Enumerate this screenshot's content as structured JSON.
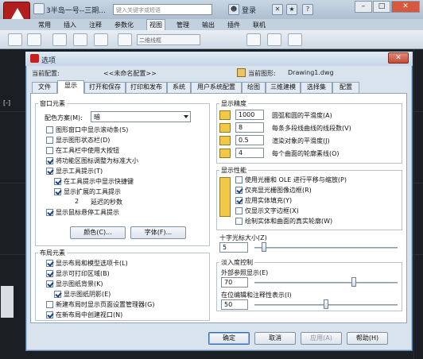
{
  "app": {
    "doc_title": "3半岛一号--三期...",
    "search_placeholder": "键入关键字或短语",
    "login": "登录",
    "ribbon_tabs": [
      "常用",
      "插入",
      "注释",
      "参数化",
      "视图",
      "管理",
      "输出",
      "插件",
      "联机"
    ],
    "active_ribbon_tab": "视图",
    "visual_style": "二维线框",
    "view_label": "[-]"
  },
  "dialog": {
    "title": "选项",
    "close_label": "✕",
    "current_profile_label": "当前配置:",
    "current_profile_value": "<<未命名配置>>",
    "current_drawing_label": "当前图形:",
    "current_drawing_value": "Drawing1.dwg",
    "tabs": [
      "文件",
      "显示",
      "打开和保存",
      "打印和发布",
      "系统",
      "用户系统配置",
      "绘图",
      "三维建模",
      "选择集",
      "配置"
    ],
    "active_tab": "显示",
    "window_elements": {
      "title": "窗口元素",
      "color_scheme_label": "配色方案(M):",
      "color_scheme_value": "暗",
      "checkboxes": [
        {
          "label": "图形窗口中显示滚动条(S)",
          "checked": false
        },
        {
          "label": "显示图形状态栏(D)",
          "checked": false
        },
        {
          "label": "在工具栏中使用大按钮",
          "checked": false
        },
        {
          "label": "将功能区图标调整为标准大小",
          "checked": true
        },
        {
          "label": "显示工具提示(T)",
          "checked": true
        }
      ],
      "sub_checkboxes": [
        {
          "label": "在工具提示中显示快捷键",
          "checked": true
        },
        {
          "label": "显示扩展的工具提示",
          "checked": true
        }
      ],
      "delay_value": "2",
      "delay_label": "延迟的秒数",
      "rollover_label": "显示鼠标悬停工具提示",
      "rollover_checked": true,
      "colors_button": "颜色(C)...",
      "fonts_button": "字体(F)..."
    },
    "layout_elements": {
      "title": "布局元素",
      "checkboxes": [
        {
          "label": "显示布局和模型选项卡(L)",
          "checked": true
        },
        {
          "label": "显示可打印区域(B)",
          "checked": true
        },
        {
          "label": "显示图纸背景(K)",
          "checked": true
        }
      ],
      "shadow_label": "显示图纸阴影(E)",
      "shadow_checked": true,
      "more": [
        {
          "label": "新建布局时显示页面设置管理器(G)",
          "checked": false
        },
        {
          "label": "在新布局中创建视口(N)",
          "checked": true
        }
      ]
    },
    "display_resolution": {
      "title": "显示精度",
      "rows": [
        {
          "value": "1000",
          "label": "圆弧和圆的平滑度(A)"
        },
        {
          "value": "8",
          "label": "每条多段线曲线的线段数(V)"
        },
        {
          "value": "0.5",
          "label": "渲染对象的平滑度(J)"
        },
        {
          "value": "4",
          "label": "每个曲面的轮廓素线(O)"
        }
      ]
    },
    "display_performance": {
      "title": "显示性能",
      "checkboxes": [
        {
          "label": "使用光栅和 OLE 进行平移与缩放(P)",
          "checked": false
        },
        {
          "label": "仅亮显光栅图像边框(R)",
          "checked": true
        },
        {
          "label": "应用实体填充(Y)",
          "checked": true
        },
        {
          "label": "仅显示文字边框(X)",
          "checked": false
        },
        {
          "label": "绘制实体和曲面的真实轮廓(W)",
          "checked": false
        }
      ]
    },
    "crosshair": {
      "title": "十字光标大小(Z)",
      "value": "5",
      "fraction": 0.05
    },
    "fade_control": {
      "title": "淡入度控制",
      "xref_label": "外部参照显示(E)",
      "xref_value": "70",
      "xref_fraction": 0.7,
      "inplace_label": "在位编辑和注释性表示(I)",
      "inplace_value": "50",
      "inplace_fraction": 0.5
    },
    "buttons": {
      "ok": "确定",
      "cancel": "取消",
      "apply": "应用(A)",
      "help": "帮助(H)"
    }
  }
}
